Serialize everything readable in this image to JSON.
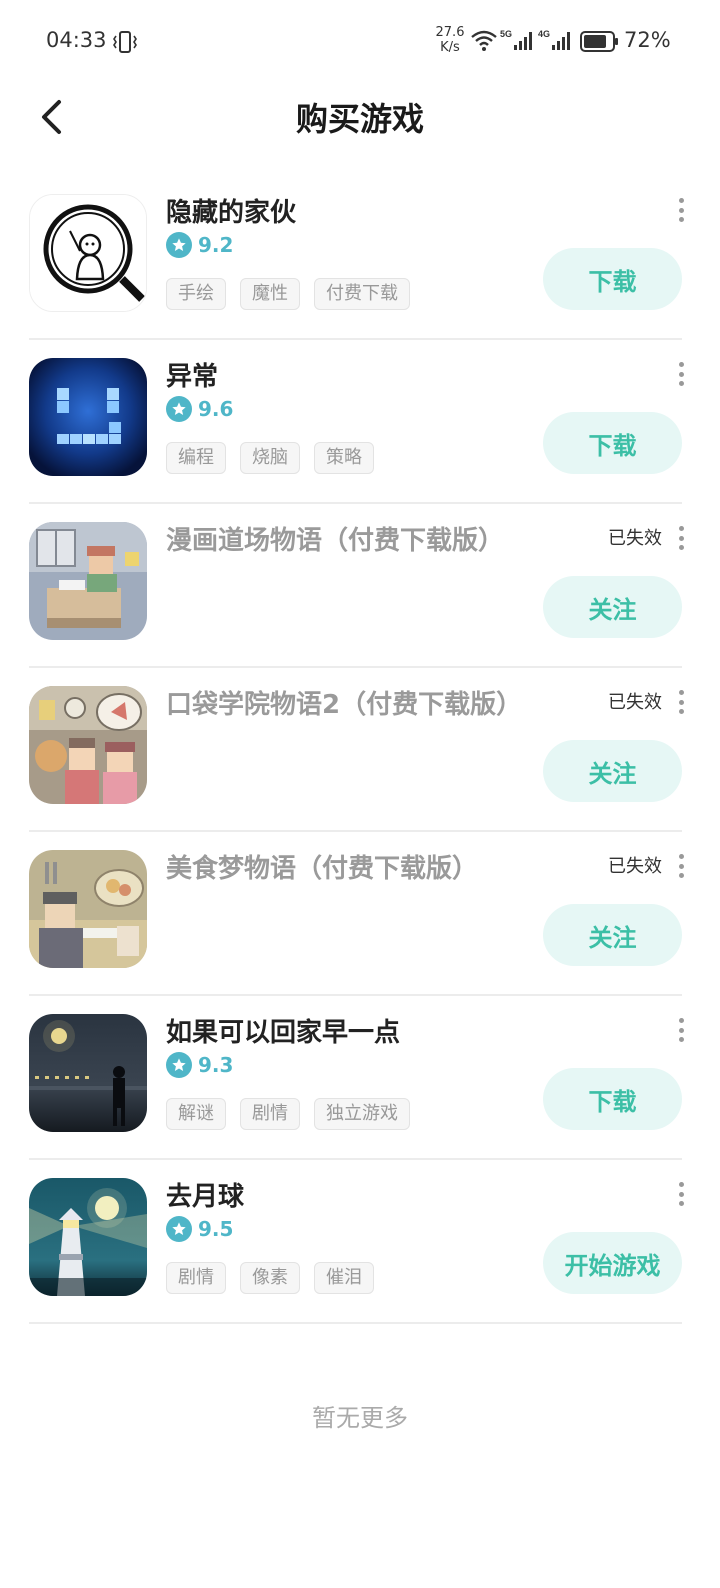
{
  "status_bar": {
    "time": "04:33",
    "speed_value": "27.6",
    "speed_unit": "K/s",
    "sig1_label": "5G",
    "sig2_label": "4G",
    "battery": "72%"
  },
  "header": {
    "title": "购买游戏",
    "back_icon": "chevron-left-icon"
  },
  "games": [
    {
      "name": "隐藏的家伙",
      "rating": "9.2",
      "tags": [
        "手绘",
        "魔性",
        "付费下载"
      ],
      "status": "",
      "action": "下载",
      "icon": "magnifier-figure-icon"
    },
    {
      "name": "异常",
      "rating": "9.6",
      "tags": [
        "编程",
        "烧脑",
        "策略"
      ],
      "status": "",
      "action": "下载",
      "icon": "pixel-smile-icon"
    },
    {
      "name": "漫画道场物语（付费下载版）",
      "rating": "",
      "tags": [],
      "status": "已失效",
      "action": "关注",
      "icon": "pixel-manga-icon"
    },
    {
      "name": "口袋学院物语2（付费下载版）",
      "rating": "",
      "tags": [],
      "status": "已失效",
      "action": "关注",
      "icon": "pixel-academy-icon"
    },
    {
      "name": "美食梦物语（付费下载版）",
      "rating": "",
      "tags": [],
      "status": "已失效",
      "action": "关注",
      "icon": "pixel-food-icon"
    },
    {
      "name": "如果可以回家早一点",
      "rating": "9.3",
      "tags": [
        "解谜",
        "剧情",
        "独立游戏"
      ],
      "status": "",
      "action": "下载",
      "icon": "night-figure-icon"
    },
    {
      "name": "去月球",
      "rating": "9.5",
      "tags": [
        "剧情",
        "像素",
        "催泪"
      ],
      "status": "",
      "action": "开始游戏",
      "icon": "lighthouse-moon-icon"
    }
  ],
  "footer": {
    "no_more": "暂无更多"
  },
  "colors": {
    "accent": "#4fb6c8",
    "button_bg": "#e6f7f5",
    "button_text": "#3cbfa6"
  }
}
